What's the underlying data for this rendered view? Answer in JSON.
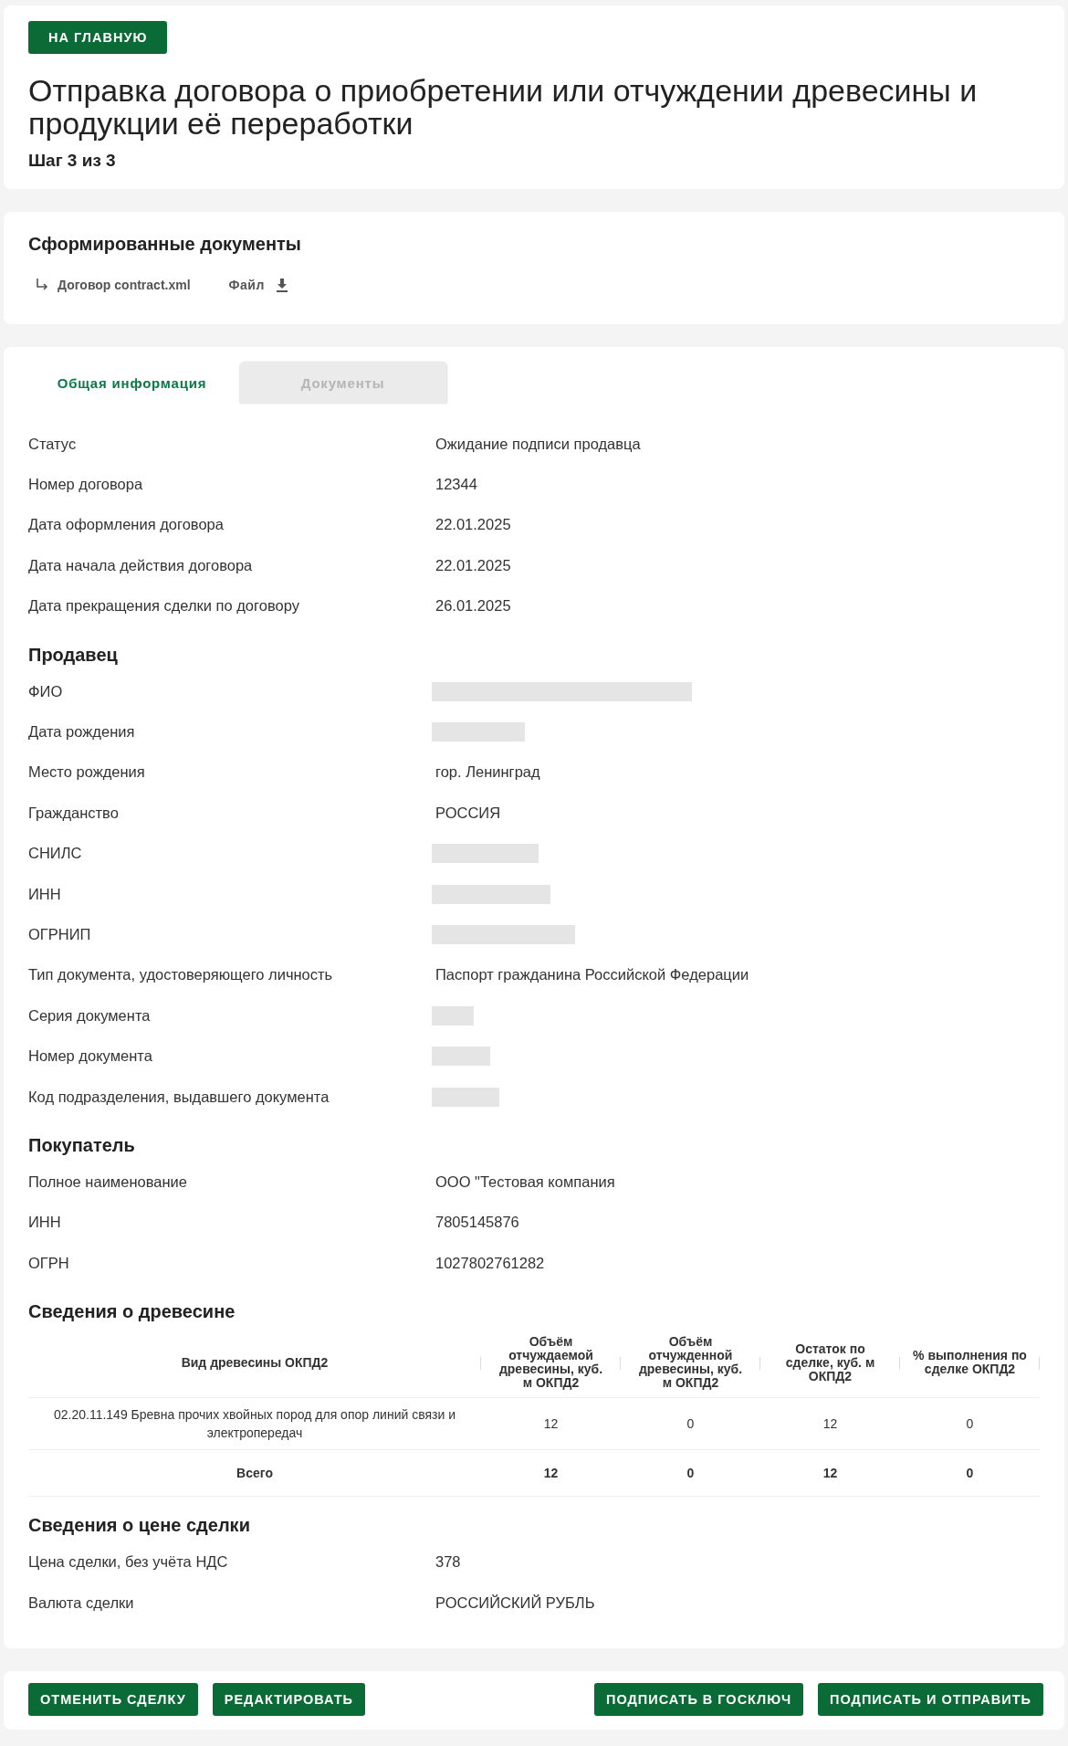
{
  "home_button": "НА ГЛАВНУЮ",
  "title": "Отправка договора о приобретении или отчуждении древесины и продукции её переработки",
  "step": "Шаг 3 из 3",
  "documents": {
    "title": "Сформированные документы",
    "items": [
      {
        "name": "Договор contract.xml",
        "file_label": "Файл"
      }
    ]
  },
  "tabs": [
    {
      "label": "Общая информация",
      "selected": true
    },
    {
      "label": "Документы",
      "selected": false
    }
  ],
  "sections": [
    {
      "kind": "fields",
      "fields": [
        {
          "label": "Статус",
          "value": "Ожидание подписи продавца"
        },
        {
          "label": "Номер договора",
          "value": "12344"
        },
        {
          "label": "Дата оформления договора",
          "value": "22.01.2025"
        },
        {
          "label": "Дата начала действия договора",
          "value": "22.01.2025"
        },
        {
          "label": "Дата прекращения сделки по договору",
          "value": "26.01.2025"
        }
      ]
    },
    {
      "kind": "fields",
      "title": "Продавец",
      "fields": [
        {
          "label": "ФИО",
          "kind": "redacted"
        },
        {
          "label": "Дата рождения",
          "kind": "redacted"
        },
        {
          "label": "Место рождения",
          "value": "гор. Ленинград"
        },
        {
          "label": "Гражданство",
          "value": "РОССИЯ"
        },
        {
          "label": "СНИЛС",
          "kind": "redacted"
        },
        {
          "label": "ИНН",
          "kind": "redacted"
        },
        {
          "label": "ОГРНИП",
          "kind": "redacted"
        },
        {
          "label": "Тип документа, удостоверяющего личность",
          "value": "Паспорт гражданина Российской Федерации"
        },
        {
          "label": "Серия документа",
          "kind": "redacted"
        },
        {
          "label": "Номер документа",
          "kind": "redacted"
        },
        {
          "label": "Код подразделения, выдавшего документа",
          "kind": "redacted"
        }
      ]
    },
    {
      "kind": "fields",
      "title": "Покупатель",
      "fields": [
        {
          "label": "Полное наименование",
          "value": "ООО \"Тестовая компания"
        },
        {
          "label": "ИНН",
          "value": "7805145876"
        },
        {
          "label": "ОГРН",
          "value": "1027802761282"
        }
      ]
    },
    {
      "kind": "table",
      "title": "Сведения о древесине",
      "columns": [
        "Вид древесины ОКПД2",
        "Объём отчуждаемой древесины, куб. м ОКПД2",
        "Объём отчужденной древесины, куб. м ОКПД2",
        "Остаток по сделке, куб. м ОКПД2",
        "% выполнения по сделке ОКПД2"
      ],
      "rows": [
        {
          "kind": "data",
          "cells": [
            "02.20.11.149 Бревна прочих хвойных пород для опор линий связи и электропередач",
            "12",
            "0",
            "12",
            "0"
          ]
        },
        {
          "kind": "total",
          "cells": [
            "Всего",
            "12",
            "0",
            "12",
            "0"
          ]
        }
      ]
    },
    {
      "kind": "fields",
      "title": "Сведения о цене сделки",
      "fields": [
        {
          "label": "Цена сделки, без учёта НДС",
          "value": "378"
        },
        {
          "label": "Валюта сделки",
          "value": "РОССИЙСКИЙ РУБЛЬ"
        }
      ]
    }
  ],
  "actions_left": [
    "ОТМЕНИТЬ СДЕЛКУ",
    "РЕДАКТИРОВАТЬ"
  ],
  "actions_right": [
    "ПОДПИСАТЬ В ГОСКЛЮЧ",
    "ПОДПИСАТЬ И ОТПРАВИТЬ"
  ]
}
